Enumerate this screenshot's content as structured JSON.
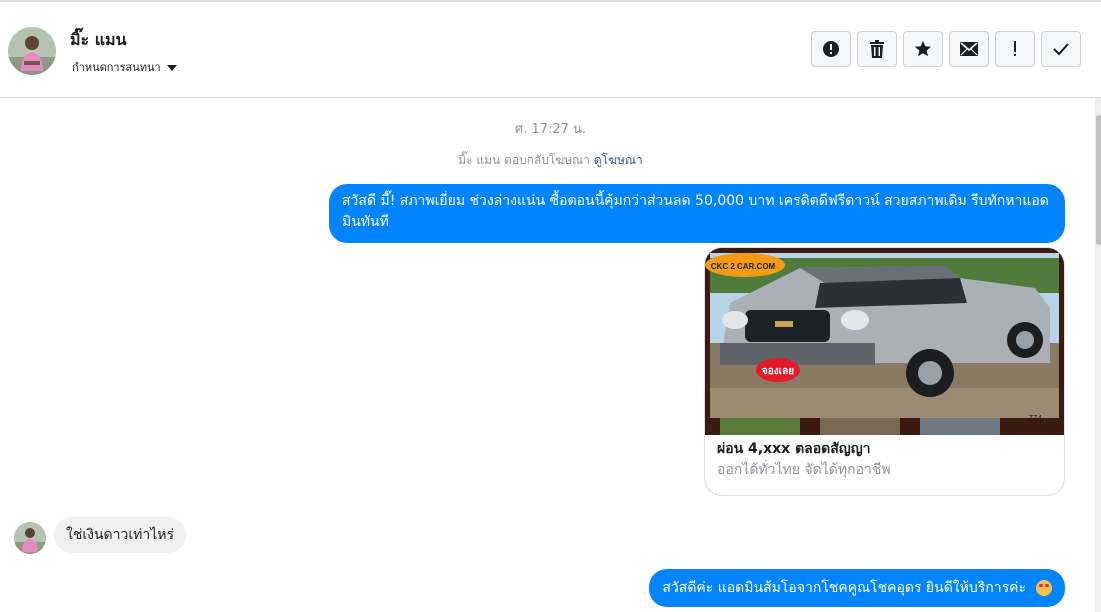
{
  "header": {
    "contact_name": "มิ๊ะ แมน",
    "conversation_settings": "กำหนดการสนทนา",
    "actions": [
      {
        "name": "report-spam-button",
        "icon": "alert-circle-icon"
      },
      {
        "name": "delete-button",
        "icon": "trash-icon"
      },
      {
        "name": "star-button",
        "icon": "star-icon"
      },
      {
        "name": "mark-unread-button",
        "icon": "envelope-icon"
      },
      {
        "name": "important-button",
        "icon": "exclamation-icon"
      },
      {
        "name": "mark-done-button",
        "icon": "checkmark-icon"
      }
    ]
  },
  "conversation": {
    "timestamp": "ศ. 17:27 น.",
    "system_message": "มิ๊ะ แมน ตอบกลับโฆษณา",
    "system_link": "ดูโฆษณา",
    "message1": "สวัสดี มี๊! สภาพเยี่ยม ช่วงล่างแน่น ซื้อตอนนี้คุ้มกว่าส่วนลด 50,000 บาท เครดิตดีฟรีดาวน์ สวยสภาพเดิม รีบทักหาแอดมินทันที",
    "ad_card": {
      "brand": "CKC 2 CAR.COM",
      "sticker": "จองเลย",
      "plate": "Z74",
      "title": "ผ่อน 4,xxx ตลอดสัญญา",
      "subtitle": "ออกได้ทั่วไทย จัดได้ทุกอาชีพ"
    },
    "incoming_message": "ใช่เงินดาวเท่าไหร่",
    "reply_message": "สวัสดีค่ะ แอดมินส้มโอจากโชคคูณโชคอุดร ยินดีให้บริการค่ะ"
  },
  "colors": {
    "outgoing_bubble": "#0084ff",
    "incoming_bubble": "#f1f0f0"
  }
}
